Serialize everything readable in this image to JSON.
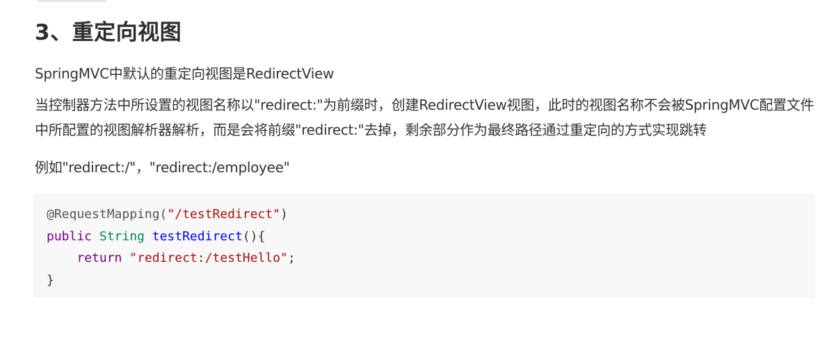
{
  "section": {
    "title": "3、重定向视图"
  },
  "paragraphs": {
    "intro": "SpringMVC中默认的重定向视图是RedirectView",
    "description": "当控制器方法中所设置的视图名称以\"redirect:\"为前缀时，创建RedirectView视图，此时的视图名称不会被SpringMVC配置文件中所配置的视图解析器解析，而是会将前缀\"redirect:\"去掉，剩余部分作为最终路径通过重定向的方式实现跳转",
    "example": "例如\"redirect:/\"，\"redirect:/employee\""
  },
  "code": {
    "line1": {
      "annotation": "@RequestMapping(",
      "string": "\"/testRedirect\"",
      "close": ")"
    },
    "line2": {
      "keyword": "public",
      "type": "String",
      "method": "testRedirect",
      "rest": "(){"
    },
    "line3": {
      "indent": "    ",
      "keyword": "return",
      "string": "\"redirect:/testHello\"",
      "end": ";"
    },
    "line4": {
      "brace": "}"
    }
  }
}
